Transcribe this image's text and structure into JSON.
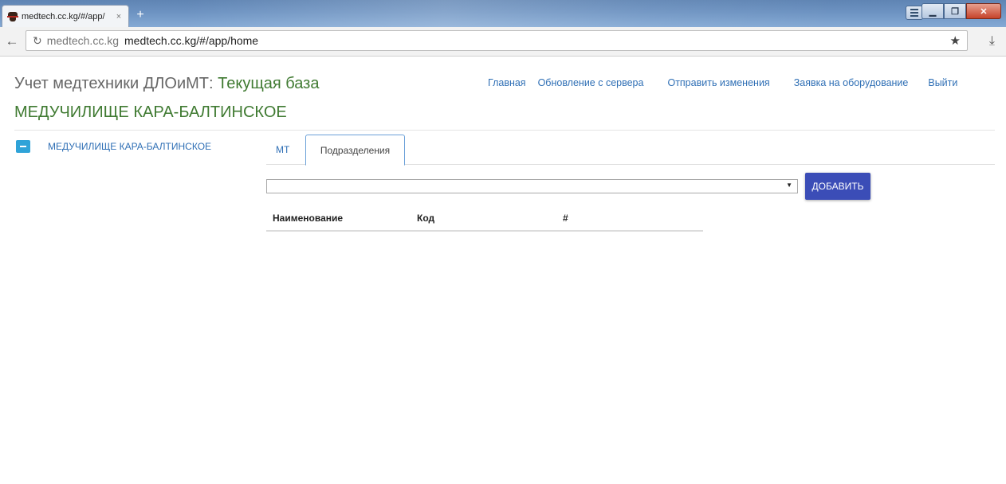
{
  "browser": {
    "tab_title": "medtech.cc.kg/#/app/",
    "tab_close": "×",
    "new_tab": "+",
    "url_host": "medtech.cc.kg",
    "url_full": "medtech.cc.kg/#/app/home",
    "back_icon": "←",
    "reload_icon": "↻",
    "star_icon": "★",
    "download_icon": "⤓"
  },
  "header": {
    "app_title": "Учет медтехники ДЛОиМТ:",
    "db_label": "Текущая база",
    "org_title": "МЕДУЧИЛИЩЕ КАРА-БАЛТИНСКОЕ",
    "accent_color": "#3f7a31",
    "link_color": "#2f6fb5"
  },
  "nav": {
    "items": [
      {
        "label": "Главная"
      },
      {
        "label": "Обновление с сервера"
      },
      {
        "label": "Отправить изменения"
      },
      {
        "label": "Заявка на оборудование"
      },
      {
        "label": "Выйти"
      }
    ]
  },
  "tree": {
    "node_label": "МЕДУЧИЛИЩЕ КАРА-БАЛТИНСКОЕ",
    "node_state": "expanded"
  },
  "tabs": {
    "items": [
      {
        "label": "МТ",
        "active": false
      },
      {
        "label": "Подразделения",
        "active": true
      }
    ]
  },
  "form": {
    "select_value": "",
    "select_arrow": "▼",
    "add_button": "ДОБАВИТЬ",
    "button_color": "#3b4db7"
  },
  "table": {
    "columns": [
      "Наименование",
      "Код",
      "#"
    ],
    "rows": []
  }
}
